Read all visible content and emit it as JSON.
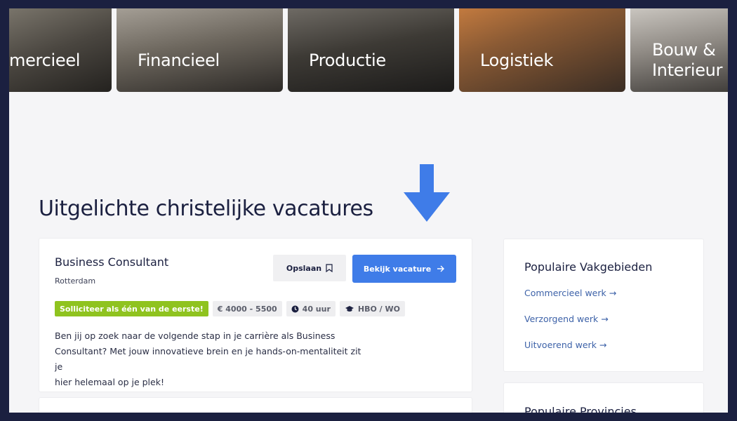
{
  "categories": [
    {
      "label": "mercieel"
    },
    {
      "label": "Financieel"
    },
    {
      "label": "Productie"
    },
    {
      "label": "Logistiek"
    },
    {
      "label_line1": "Bouw &",
      "label_line2": "Interieur"
    }
  ],
  "featured": {
    "title": "Uitgelichte christelijke vacatures"
  },
  "job": {
    "title": "Business Consultant",
    "location": "Rotterdam",
    "save_label": "Opslaan",
    "view_label": "Bekijk vacature",
    "tags": {
      "apply_first": "Solliciteer als één van de eerste!",
      "salary": "€ 4000 - 5500",
      "hours": "40 uur",
      "education": "HBO / WO"
    },
    "description_line1": "Ben jij op zoek naar de volgende stap in je carrière als Business",
    "description_line2": "Consultant? Met jouw innovatieve brein en je hands-on-mentaliteit zit je",
    "description_line3": "hier helemaal op je plek!"
  },
  "sidebar": {
    "vakgebieden_title": "Populaire Vakgebieden",
    "links": [
      {
        "label": "Commercieel werk →"
      },
      {
        "label": "Verzorgend werk →"
      },
      {
        "label": "Uitvoerend werk →"
      }
    ],
    "provincies_title": "Populaire Provincies"
  },
  "colors": {
    "accent": "#3f7ce8",
    "green_badge": "#8fc31f",
    "navy": "#1b2040"
  },
  "icons": {
    "arrow": "arrow-down-icon",
    "bookmark": "bookmark-icon",
    "clock": "clock-icon",
    "graduation": "graduation-cap-icon"
  }
}
